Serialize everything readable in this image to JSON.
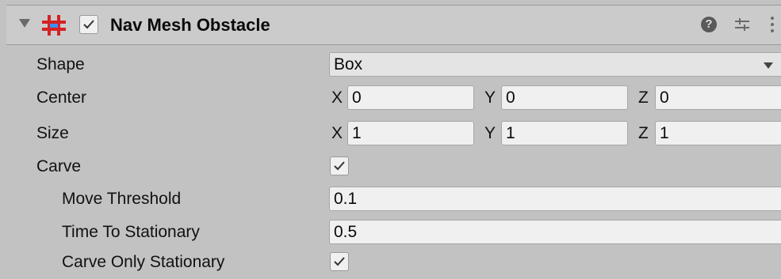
{
  "component": {
    "title": "Nav Mesh Obstacle",
    "enabled": true,
    "icon": "nav-mesh-obstacle-icon",
    "help_glyph": "?"
  },
  "properties": {
    "shape": {
      "label": "Shape",
      "value": "Box"
    },
    "center": {
      "label": "Center",
      "x_label": "X",
      "x": "0",
      "y_label": "Y",
      "y": "0",
      "z_label": "Z",
      "z": "0"
    },
    "size": {
      "label": "Size",
      "x_label": "X",
      "x": "1",
      "y_label": "Y",
      "y": "1",
      "z_label": "Z",
      "z": "1"
    },
    "carve": {
      "label": "Carve",
      "checked": true
    },
    "move_threshold": {
      "label": "Move Threshold",
      "value": "0.1"
    },
    "time_to_stationary": {
      "label": "Time To Stationary",
      "value": "0.5"
    },
    "carve_only_stationary": {
      "label": "Carve Only Stationary",
      "checked": true
    }
  },
  "colors": {
    "background": "#c2c2c2",
    "header": "#cbcbcb",
    "field": "#f0f0f0",
    "icon_red": "#d42323"
  }
}
